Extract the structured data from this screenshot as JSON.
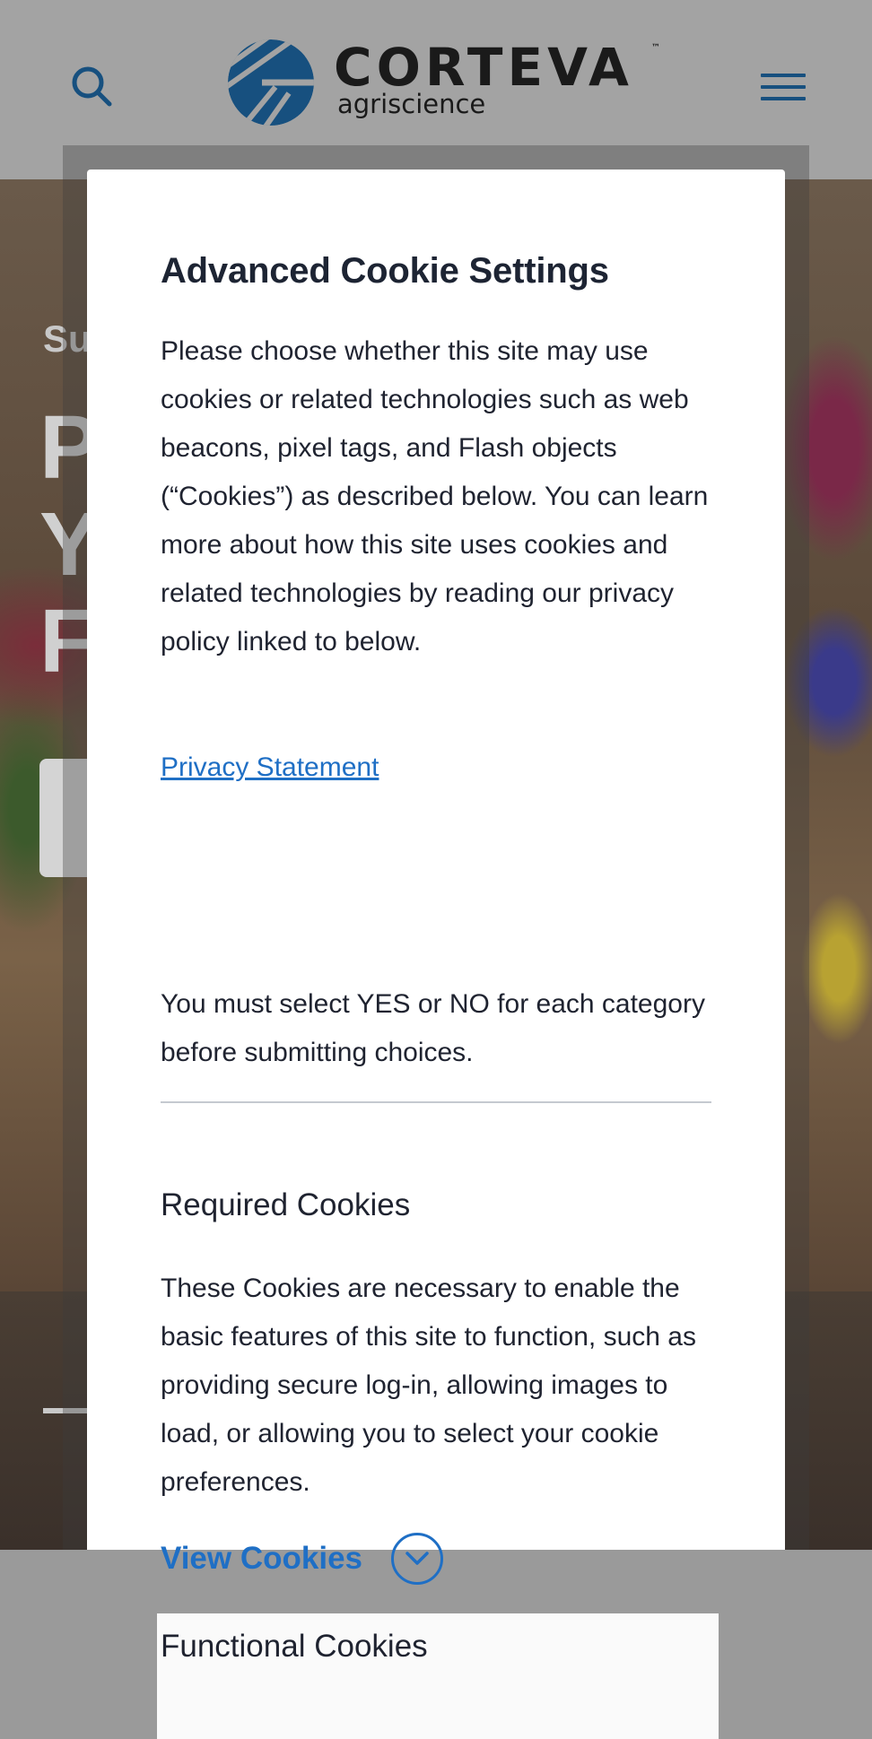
{
  "header": {
    "logo_word": "CORTEVA",
    "logo_tm": "™",
    "logo_sub": "agriscience",
    "icons": {
      "search": "search-icon",
      "menu": "hamburger-menu-icon"
    }
  },
  "hero": {
    "kicker": "Su",
    "big_lines": [
      "P",
      "Y",
      "F"
    ]
  },
  "modal": {
    "title": "Advanced Cookie Settings",
    "intro": "Please choose whether this site may use cookies or related technologies such as web beacons, pixel tags, and Flash objects (“Cookies”) as described below. You can learn more about how this site uses cookies and related technologies by reading our privacy policy linked to below.",
    "privacy_link": "Privacy Statement",
    "must_select": "You must select YES or NO for each category before submitting choices.",
    "required": {
      "title": "Required Cookies",
      "description": "These Cookies are necessary to enable the basic features of this site to function, such as providing secure log-in, allowing images to load, or allowing you to select your cookie preferences.",
      "view_label": "View Cookies"
    },
    "functional": {
      "title": "Functional Cookies"
    }
  },
  "colors": {
    "accent_blue": "#1f6fc5",
    "logo_blue": "#17507f",
    "text_dark": "#1f2330"
  }
}
